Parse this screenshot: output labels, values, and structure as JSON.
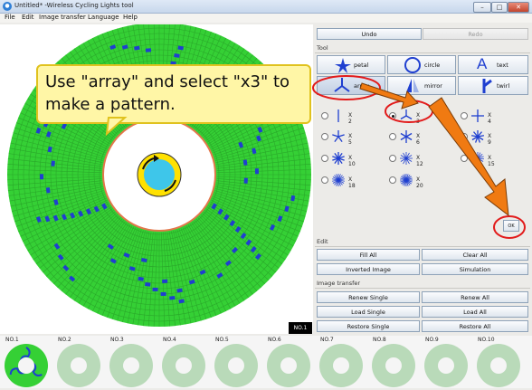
{
  "window": {
    "title": "Untitled* -Wireless Cycling Lights tool",
    "min_label": "–",
    "max_label": "□",
    "close_label": "✕"
  },
  "menu": {
    "items": [
      "File",
      "Edit",
      "Image transfer",
      "Language",
      "Help"
    ]
  },
  "canvas": {
    "ring_color": "#35d035",
    "hub_outline_color": "#ffe100",
    "hub_center_color": "#3ec6ea",
    "pixel_color": "#1f3fd0",
    "current_label": "NO.1"
  },
  "panel": {
    "undo_label": "Undo",
    "redo_label": "Redo",
    "tool_section": "Tool",
    "tools": {
      "petal": "petal",
      "circle": "circle",
      "text": "text",
      "array": "array",
      "mirror": "mirror",
      "twirl": "twirl"
    },
    "array_options": [
      "X 2",
      "X 3",
      "X 4",
      "X 5",
      "X 6",
      "X 9",
      "X 10",
      "X 12",
      "X 15",
      "X 18",
      "X 20"
    ],
    "selected_option": "X 3",
    "ok_label": "OK",
    "edit_section": "Edit",
    "fill_all": "Fill All",
    "clear_all": "Clear All",
    "inverted_image": "Inverted Image",
    "simulation": "Simulation",
    "transfer_section": "Image transfer",
    "renew_single": "Renew Single",
    "renew_all": "Renew All",
    "load_single": "Load Single",
    "load_all": "Load All",
    "restore_single": "Restore Single",
    "restore_all": "Restore All"
  },
  "thumbnails": [
    "NO.1",
    "NO.2",
    "NO.3",
    "NO.4",
    "NO.5",
    "NO.6",
    "NO.7",
    "NO.8",
    "NO.9",
    "NO.10"
  ],
  "callout": {
    "text": "Use \"array\" and select \"x3\" to make a pattern."
  },
  "annotation_colors": {
    "highlight": "#e21b1b",
    "arrow": "#f07a12"
  }
}
